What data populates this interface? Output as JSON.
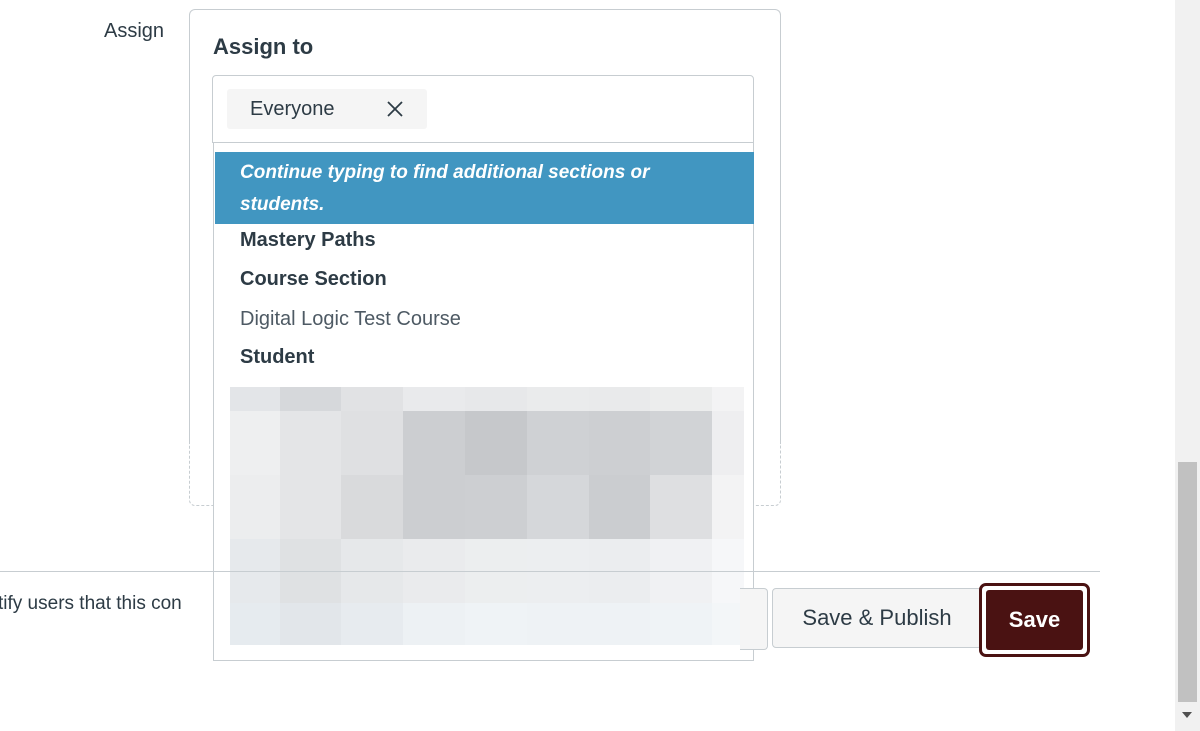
{
  "assign_row": {
    "label": "Assign",
    "card_title": "Assign to",
    "selected_chip": "Everyone"
  },
  "dropdown": {
    "hint": "Continue typing to find additional sections or students.",
    "options": [
      {
        "label": "Mastery Paths",
        "style": "group"
      },
      {
        "label": "Course Section",
        "style": "group"
      },
      {
        "label": "Digital Logic Test Course",
        "style": "item"
      },
      {
        "label": "Student",
        "style": "group"
      }
    ]
  },
  "footer": {
    "notify_text": "tify users that this con",
    "save_publish_label": "Save & Publish",
    "save_label": "Save"
  },
  "colors": {
    "hint_bg": "#4196c1",
    "save_bg": "#4a1212",
    "border": "#c7cdd1",
    "text": "#2d3b45"
  }
}
